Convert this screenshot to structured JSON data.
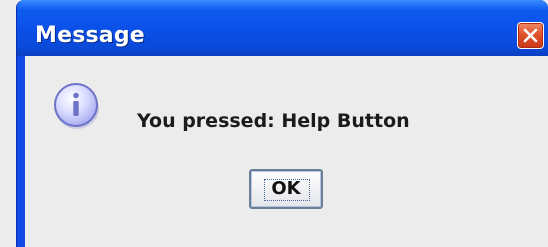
{
  "window": {
    "title": "Message"
  },
  "dialog": {
    "message": "You pressed: Help Button",
    "icon": "information-icon",
    "ok_label": "OK"
  },
  "colors": {
    "titlebar": "#0a4fe8",
    "close_button": "#e0532a",
    "background": "#ececec"
  }
}
